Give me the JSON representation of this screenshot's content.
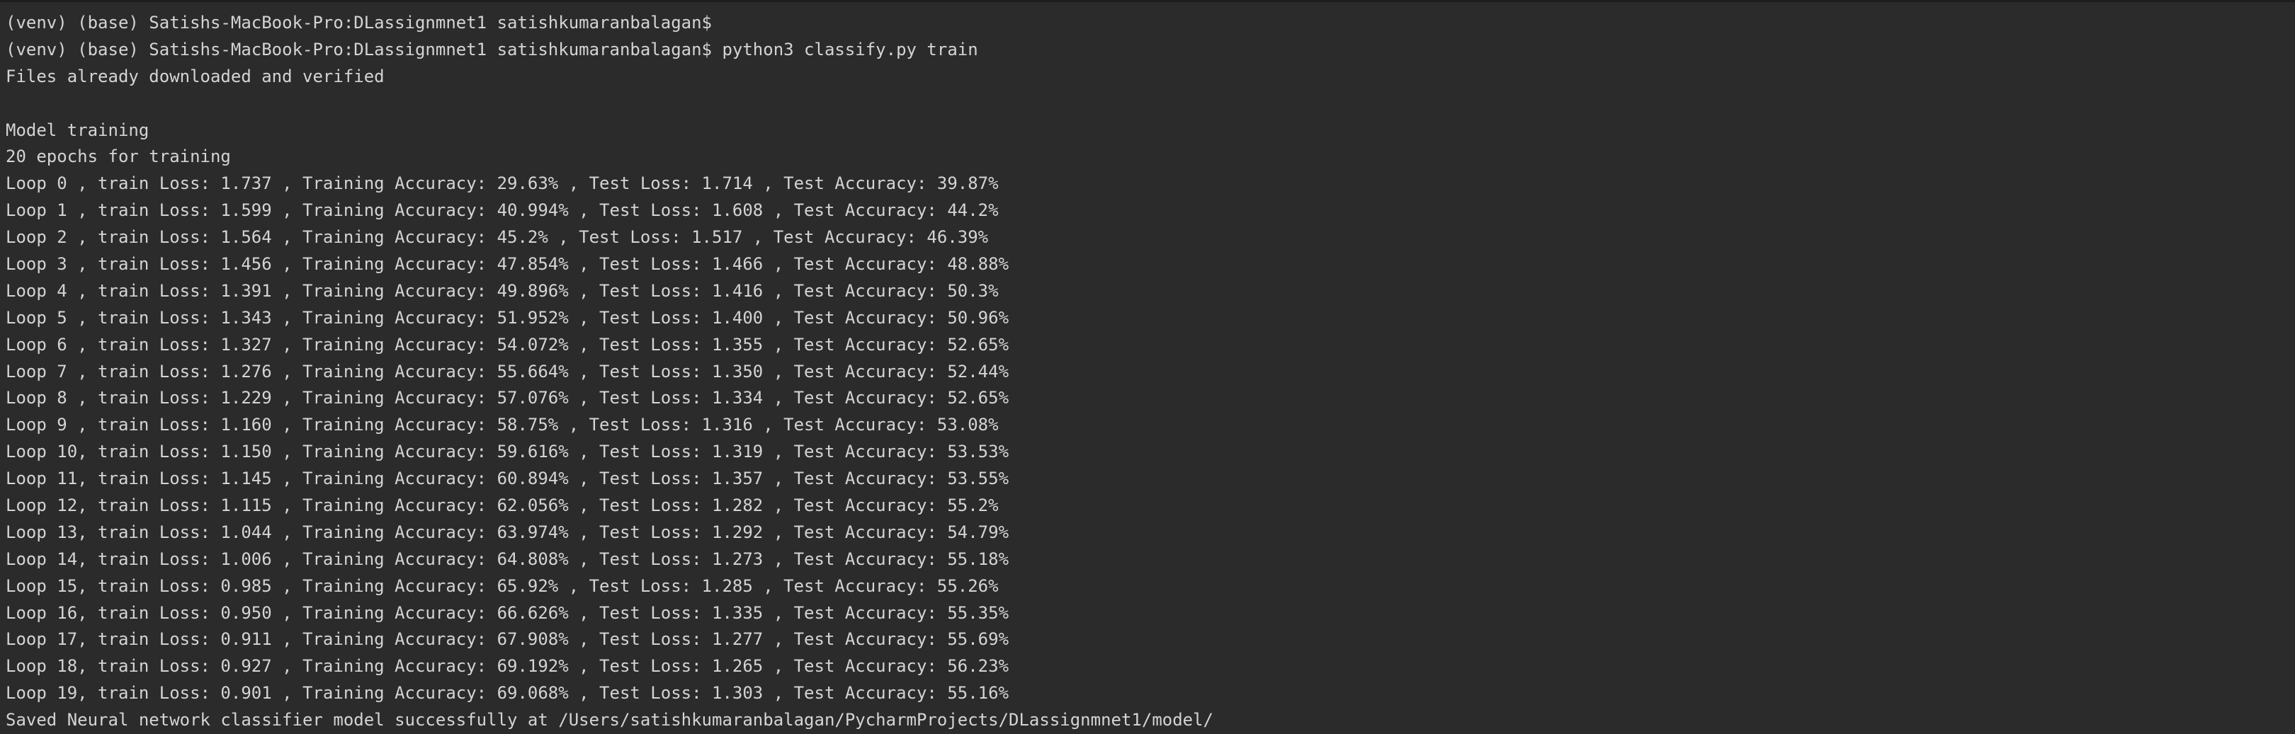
{
  "terminal": {
    "lines": [
      "(venv) (base) Satishs-MacBook-Pro:DLassignmnet1 satishkumaranbalagan$",
      "(venv) (base) Satishs-MacBook-Pro:DLassignmnet1 satishkumaranbalagan$ python3 classify.py train",
      "Files already downloaded and verified",
      "",
      "Model training",
      "20 epochs for training",
      "Loop 0 , train Loss: 1.737 , Training Accuracy: 29.63% , Test Loss: 1.714 , Test Accuracy: 39.87%",
      "Loop 1 , train Loss: 1.599 , Training Accuracy: 40.994% , Test Loss: 1.608 , Test Accuracy: 44.2%",
      "Loop 2 , train Loss: 1.564 , Training Accuracy: 45.2% , Test Loss: 1.517 , Test Accuracy: 46.39%",
      "Loop 3 , train Loss: 1.456 , Training Accuracy: 47.854% , Test Loss: 1.466 , Test Accuracy: 48.88%",
      "Loop 4 , train Loss: 1.391 , Training Accuracy: 49.896% , Test Loss: 1.416 , Test Accuracy: 50.3%",
      "Loop 5 , train Loss: 1.343 , Training Accuracy: 51.952% , Test Loss: 1.400 , Test Accuracy: 50.96%",
      "Loop 6 , train Loss: 1.327 , Training Accuracy: 54.072% , Test Loss: 1.355 , Test Accuracy: 52.65%",
      "Loop 7 , train Loss: 1.276 , Training Accuracy: 55.664% , Test Loss: 1.350 , Test Accuracy: 52.44%",
      "Loop 8 , train Loss: 1.229 , Training Accuracy: 57.076% , Test Loss: 1.334 , Test Accuracy: 52.65%",
      "Loop 9 , train Loss: 1.160 , Training Accuracy: 58.75% , Test Loss: 1.316 , Test Accuracy: 53.08%",
      "Loop 10, train Loss: 1.150 , Training Accuracy: 59.616% , Test Loss: 1.319 , Test Accuracy: 53.53%",
      "Loop 11, train Loss: 1.145 , Training Accuracy: 60.894% , Test Loss: 1.357 , Test Accuracy: 53.55%",
      "Loop 12, train Loss: 1.115 , Training Accuracy: 62.056% , Test Loss: 1.282 , Test Accuracy: 55.2%",
      "Loop 13, train Loss: 1.044 , Training Accuracy: 63.974% , Test Loss: 1.292 , Test Accuracy: 54.79%",
      "Loop 14, train Loss: 1.006 , Training Accuracy: 64.808% , Test Loss: 1.273 , Test Accuracy: 55.18%",
      "Loop 15, train Loss: 0.985 , Training Accuracy: 65.92% , Test Loss: 1.285 , Test Accuracy: 55.26%",
      "Loop 16, train Loss: 0.950 , Training Accuracy: 66.626% , Test Loss: 1.335 , Test Accuracy: 55.35%",
      "Loop 17, train Loss: 0.911 , Training Accuracy: 67.908% , Test Loss: 1.277 , Test Accuracy: 55.69%",
      "Loop 18, train Loss: 0.927 , Training Accuracy: 69.192% , Test Loss: 1.265 , Test Accuracy: 56.23%",
      "Loop 19, train Loss: 0.901 , Training Accuracy: 69.068% , Test Loss: 1.303 , Test Accuracy: 55.16%",
      "Saved Neural network classifier model successfully at /Users/satishkumaranbalagan/PycharmProjects/DLassignmnet1/model/"
    ]
  },
  "colors": {
    "background": "#2b2b2b",
    "text": "#d4d4d4"
  }
}
